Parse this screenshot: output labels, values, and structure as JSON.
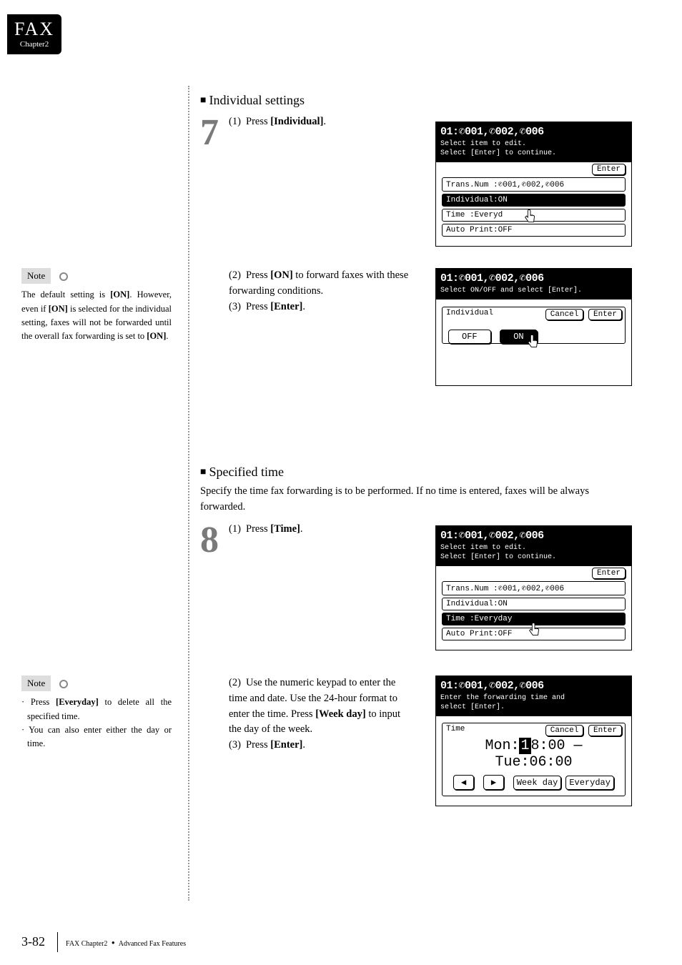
{
  "tab": {
    "title": "FAX",
    "subtitle": "Chapter2"
  },
  "section1": {
    "heading": "Individual settings",
    "step7_1": "Press ",
    "step7_1b": "[Individual]",
    "step7_2a": "Press ",
    "step7_2b": "[ON]",
    "step7_2c": " to forward faxes with these forwarding conditions.",
    "step7_3a": "Press ",
    "step7_3b": "[Enter]"
  },
  "note1": {
    "label": "Note",
    "text_a": "The default setting is ",
    "text_b": "[ON]",
    "text_c": ". However, even if ",
    "text_d": "[ON]",
    "text_e": " is selected for the individual setting, faxes will not be forwarded until the overall fax forwarding is set to ",
    "text_f": "[ON]",
    "text_g": "."
  },
  "screenA": {
    "title": "01:✆001,✆002,✆006",
    "sub1": "Select item to edit.",
    "sub2": "Select [Enter] to continue.",
    "enter": "Enter",
    "r1": "Trans.Num :✆001,✆002,✆006",
    "r2": "Individual:ON",
    "r3": "Time      :Everyd",
    "r4": "Auto Print:OFF"
  },
  "screenB": {
    "title": "01:✆001,✆002,✆006",
    "sub1": "Select ON/OFF and select [Enter].",
    "label": "Individual",
    "cancel": "Cancel",
    "enter": "Enter",
    "off": "OFF",
    "on": "ON"
  },
  "section2": {
    "heading": "Specified time",
    "para": "Specify the time fax forwarding is to be performed. If no time is entered, faxes will be always forwarded.",
    "step8_1a": "Press ",
    "step8_1b": "[Time]",
    "step8_2": "Use the numeric keypad to enter the time and date. Use the 24-hour format to enter the time. Press ",
    "step8_2b": "[Week day]",
    "step8_2c": " to input the day of the week.",
    "step8_3a": "Press ",
    "step8_3b": "[Enter]"
  },
  "note2": {
    "label": "Note",
    "li1a": "Press ",
    "li1b": "[Everyday]",
    "li1c": " to delete all the specified time.",
    "li2": "You can also enter either the day or time."
  },
  "screenC": {
    "title": "01:✆001,✆002,✆006",
    "sub1": "Select item to edit.",
    "sub2": "Select [Enter] to continue.",
    "enter": "Enter",
    "r1": "Trans.Num :✆001,✆002,✆006",
    "r2": "Individual:ON",
    "r3": "Time      :Everyday",
    "r4": "Auto Print:OFF"
  },
  "screenD": {
    "title": "01:✆001,✆002,✆006",
    "sub1": "Enter the forwarding time and",
    "sub2": "select [Enter].",
    "label": "Time",
    "cancel": "Cancel",
    "enter": "Enter",
    "time_prefix": "Mon:",
    "time_hl": "1",
    "time_mid": "8:00 — Tue:06:00",
    "left": "◀",
    "right": "▶",
    "weekday": "Week day",
    "everyday": "Everyday"
  },
  "footer": {
    "page": "3-82",
    "txt": "FAX Chapter2",
    "txt2": "Advanced Fax Features"
  }
}
